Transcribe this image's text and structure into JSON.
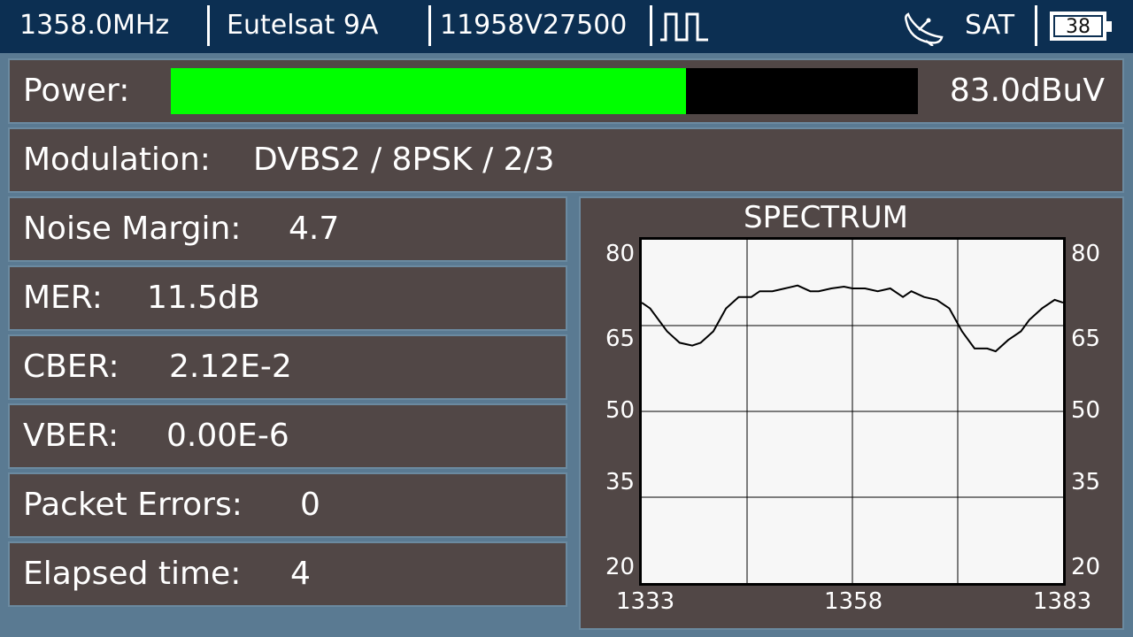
{
  "header": {
    "frequency": "1358.0MHz",
    "satellite": "Eutelsat 9A",
    "transponder": "11958V27500",
    "pulse_icon": "square-wave-icon",
    "dish_icon": "satellite-dish-icon",
    "mode": "SAT",
    "battery": "38"
  },
  "power": {
    "label": "Power:",
    "value": "83.0dBuV",
    "fill_percent": 69,
    "bar_color": "#00ff00"
  },
  "modulation": {
    "label": "Modulation:",
    "value": "DVBS2 / 8PSK / 2/3"
  },
  "measurements": [
    {
      "label": "Noise Margin:",
      "value": "4.7"
    },
    {
      "label": "MER:",
      "value": "11.5dB"
    },
    {
      "label": "CBER:",
      "value": "2.12E-2"
    },
    {
      "label": "VBER:",
      "value": "0.00E-6"
    },
    {
      "label": "Packet Errors:",
      "value": "0"
    },
    {
      "label": "Elapsed time:",
      "value": "4"
    }
  ],
  "spectrum": {
    "title": "SPECTRUM",
    "y_ticks_left": [
      "80",
      "65",
      "50",
      "35",
      "20"
    ],
    "y_ticks_right": [
      "80",
      "65",
      "50",
      "35",
      "20"
    ],
    "x_ticks": [
      "1333",
      "1358",
      "1383"
    ]
  },
  "chart_data": {
    "type": "line",
    "title": "SPECTRUM",
    "xlim": [
      1333,
      1383
    ],
    "ylim": [
      20,
      80
    ],
    "grid": true,
    "x": [
      1333,
      1334,
      1336,
      1337.5,
      1339,
      1340,
      1341.5,
      1343,
      1344.5,
      1346,
      1347,
      1348.5,
      1350,
      1351.5,
      1353,
      1354,
      1355.5,
      1357,
      1358,
      1359.5,
      1361,
      1362.5,
      1364,
      1365,
      1366.5,
      1368,
      1369.5,
      1371,
      1372.5,
      1374,
      1375,
      1376.5,
      1378,
      1379,
      1380.5,
      1382,
      1383
    ],
    "y": [
      69,
      68,
      64,
      62,
      61.5,
      62,
      64,
      68,
      70,
      70,
      71,
      71,
      71.5,
      72,
      71,
      71,
      71.5,
      71.8,
      71.5,
      71.5,
      71,
      71.5,
      70,
      71,
      70,
      69.5,
      68,
      64,
      61,
      61,
      60.5,
      62.5,
      64,
      66,
      68,
      69.5,
      69
    ]
  }
}
